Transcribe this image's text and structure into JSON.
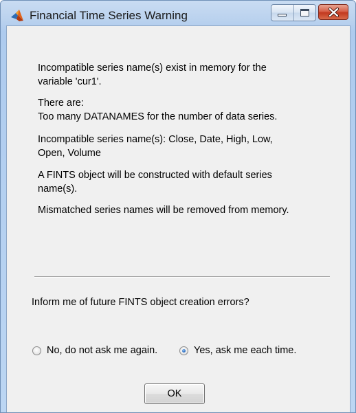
{
  "window": {
    "title": "Financial Time Series Warning"
  },
  "message": {
    "paragraph1": [
      "Incompatible series name(s) exist in memory for the",
      "variable 'cur1'."
    ],
    "paragraph2": [
      "There are:",
      "Too many DATANAMES for the number of data series."
    ],
    "paragraph3": [
      "Incompatible series name(s): Close, Date, High, Low,",
      "Open, Volume"
    ],
    "paragraph4": [
      "A FINTS object will be constructed with default series",
      "name(s)."
    ],
    "paragraph5": [
      "Mismatched series names will be removed from memory."
    ]
  },
  "question": "Inform me of future FINTS object creation errors?",
  "options": [
    {
      "label": "No, do not ask me again.",
      "selected": false
    },
    {
      "label": "Yes, ask me each time.",
      "selected": true
    }
  ],
  "ok_label": "OK",
  "icons": {
    "app": "matlab-icon",
    "minimize": "minimize-icon",
    "maximize": "maximize-icon",
    "close": "close-icon"
  },
  "colors": {
    "titlebar": "#b9d1ee",
    "client_bg": "#f0f0f0",
    "close_button": "#c2391f",
    "radio_selected": "#2b6fc4"
  }
}
